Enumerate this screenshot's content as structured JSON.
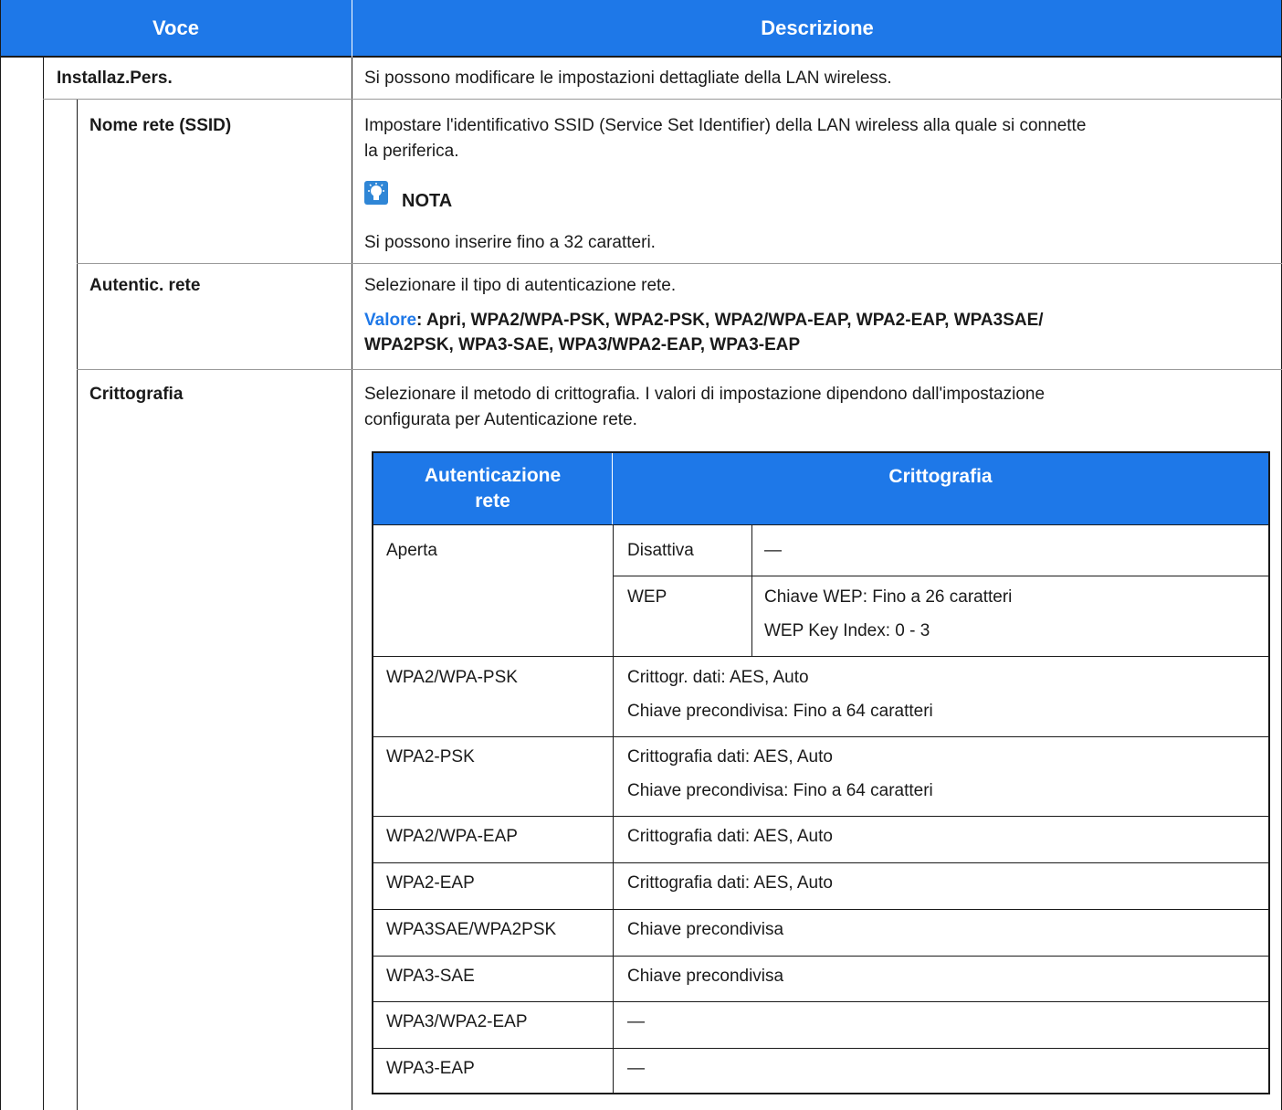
{
  "header": {
    "col_voce": "Voce",
    "col_descrizione": "Descrizione"
  },
  "rows": {
    "installaz": {
      "label": "Installaz.Pers.",
      "desc": "Si possono modificare le impostazioni dettagliate della LAN wireless."
    },
    "ssid": {
      "label": "Nome rete (SSID)",
      "desc_line1": "Impostare l'identificativo SSID (Service Set Identifier) della LAN wireless alla quale si connette",
      "desc_line2": "la periferica.",
      "note_title": "NOTA",
      "note_text": "Si possono inserire fino a 32 caratteri."
    },
    "autentic": {
      "label": "Autentic. rete",
      "desc": "Selezionare il tipo di autenticazione rete.",
      "valore_label": "Valore",
      "valore_line1": ": Apri, WPA2/WPA-PSK, WPA2-PSK, WPA2/WPA-EAP, WPA2-EAP, WPA3SAE/",
      "valore_line2": "WPA2PSK, WPA3-SAE, WPA3/WPA2-EAP, WPA3-EAP"
    },
    "crittografia": {
      "label": "Crittografia",
      "desc_line1": "Selezionare il metodo di crittografia. I valori di impostazione dipendono dall'impostazione",
      "desc_line2": "configurata per Autenticazione rete."
    }
  },
  "inner_table": {
    "header_auth_line1": "Autenticazione",
    "header_auth_line2": "rete",
    "header_crypt": "Crittografia",
    "aperta": {
      "auth": "Aperta",
      "disattiva": "Disattiva",
      "disattiva_val": "—",
      "wep": "WEP",
      "wep_line1": "Chiave WEP: Fino a 26 caratteri",
      "wep_line2": "WEP Key Index: 0 - 3"
    },
    "rows": [
      {
        "auth": "WPA2/WPA-PSK",
        "line1": "Crittogr. dati: AES, Auto",
        "line2": "Chiave precondivisa: Fino a 64 caratteri"
      },
      {
        "auth": "WPA2-PSK",
        "line1": "Crittografia dati: AES, Auto",
        "line2": "Chiave precondivisa: Fino a 64 caratteri"
      },
      {
        "auth": "WPA2/WPA-EAP",
        "line1": "Crittografia dati: AES, Auto"
      },
      {
        "auth": "WPA2-EAP",
        "line1": "Crittografia dati: AES, Auto"
      },
      {
        "auth": "WPA3SAE/WPA2PSK",
        "line1": "Chiave precondivisa"
      },
      {
        "auth": "WPA3-SAE",
        "line1": "Chiave precondivisa"
      },
      {
        "auth": "WPA3/WPA2-EAP",
        "line1": "—"
      },
      {
        "auth": "WPA3-EAP",
        "line1": "—"
      }
    ]
  },
  "colors": {
    "accent": "#1e78e8"
  },
  "icons": {
    "note": "lightbulb-note-icon"
  }
}
